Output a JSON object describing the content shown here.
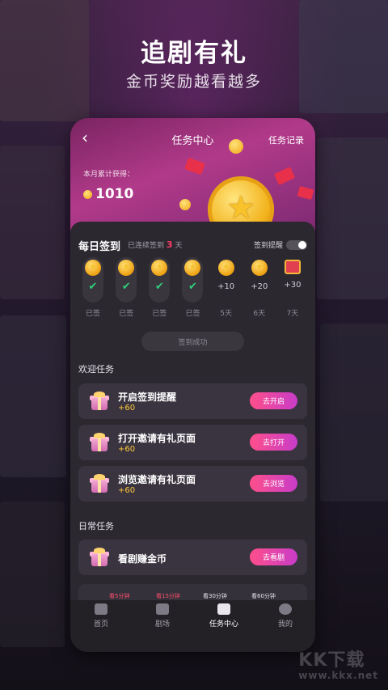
{
  "promo": {
    "headline": "追剧有礼",
    "subline": "金币奖励越看越多"
  },
  "nav": {
    "back_icon": "chevron-left-icon",
    "title": "任务中心",
    "record": "任务记录"
  },
  "earnings": {
    "label": "本月累计获得：",
    "amount": "1010"
  },
  "sign_in": {
    "title": "每日签到",
    "streak_prefix": "已连续签到",
    "streak_days": "3",
    "streak_suffix": "天",
    "reminder_label": "签到提醒",
    "days": [
      {
        "reward": "",
        "status": "checked",
        "label": "已签"
      },
      {
        "reward": "",
        "status": "checked",
        "label": "已签"
      },
      {
        "reward": "",
        "status": "checked",
        "label": "已签"
      },
      {
        "reward": "",
        "status": "checked",
        "label": "已签"
      },
      {
        "reward": "+10",
        "status": "pending",
        "label": "5天"
      },
      {
        "reward": "+20",
        "status": "pending",
        "label": "6天"
      },
      {
        "reward": "+30",
        "status": "chest",
        "label": "7天"
      }
    ],
    "done_button": "签到成功"
  },
  "welcome_section": "欢迎任务",
  "welcome_tasks": [
    {
      "name": "开启签到提醒",
      "reward": "+60",
      "button": "去开启"
    },
    {
      "name": "打开邀请有礼页面",
      "reward": "+60",
      "button": "去打开"
    },
    {
      "name": "浏览邀请有礼页面",
      "reward": "+60",
      "button": "去浏览"
    }
  ],
  "daily_section": "日常任务",
  "daily_tasks": [
    {
      "name": "看剧赚金币",
      "button": "去看剧"
    }
  ],
  "watch_steps": [
    "看5分钟",
    "看15分钟",
    "看30分钟",
    "看60分钟"
  ],
  "tabs": [
    {
      "label": "首页",
      "icon": "home-icon"
    },
    {
      "label": "剧场",
      "icon": "play-icon"
    },
    {
      "label": "任务中心",
      "icon": "gift-icon"
    },
    {
      "label": "我的",
      "icon": "profile-icon"
    }
  ],
  "watermark": {
    "main": "KK下载",
    "sub": "www.kkx.net"
  },
  "colors": {
    "accent": "#ff4f8b",
    "accent2": "#c83cc9",
    "coin": "#f0a516",
    "check": "#2fd07a",
    "streak": "#ff3d6b"
  }
}
